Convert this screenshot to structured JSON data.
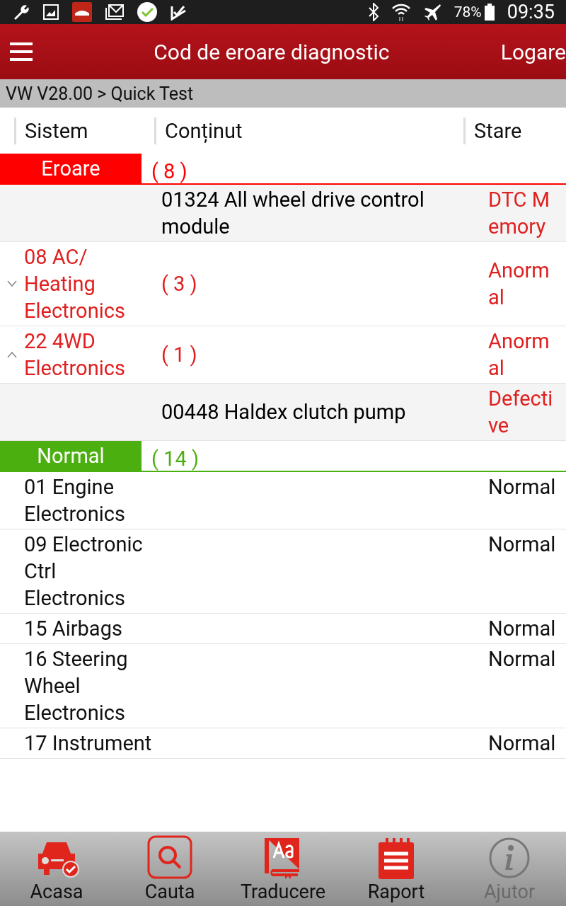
{
  "status_bar": {
    "battery": "78%",
    "time": "09:35"
  },
  "header": {
    "title": "Cod de eroare diagnostic",
    "action": "Logare"
  },
  "breadcrumb": "VW V28.00 > Quick Test",
  "columns": [
    "Sistem",
    "Conținut",
    "Stare"
  ],
  "sections": [
    {
      "kind": "error",
      "label": "Eroare",
      "count": "( 8 )",
      "rows": [
        {
          "kind": "detail",
          "content": "01324 All wheel drive control module",
          "status": "DTC Memory"
        },
        {
          "kind": "system",
          "system": "08 AC/ Heating Electronics",
          "count": "( 3 )",
          "status": "Anormal",
          "expanded": false
        },
        {
          "kind": "system",
          "system": "22 4WD Electronics",
          "count": "( 1 )",
          "status": "Anormal",
          "expanded": true
        },
        {
          "kind": "detail",
          "content": "00448 Haldex clutch pump",
          "status": "Defective"
        }
      ]
    },
    {
      "kind": "normal",
      "label": "Normal",
      "count": "( 14 )",
      "rows": [
        {
          "kind": "plain",
          "system": "01 Engine Electronics",
          "status": "Normal"
        },
        {
          "kind": "plain",
          "system": "09 Electronic Ctrl Electronics",
          "status": "Normal"
        },
        {
          "kind": "plain",
          "system": "15 Airbags",
          "status": "Normal"
        },
        {
          "kind": "plain",
          "system": "16 Steering Wheel Electronics",
          "status": "Normal"
        },
        {
          "kind": "plain",
          "system": "17 Instrument",
          "status": "Normal"
        }
      ]
    }
  ],
  "nav": [
    {
      "kind": "car",
      "label": "Acasa",
      "disabled": false
    },
    {
      "kind": "search",
      "label": "Cauta",
      "disabled": false
    },
    {
      "kind": "translate",
      "label": "Traducere",
      "disabled": false
    },
    {
      "kind": "report",
      "label": "Raport",
      "disabled": false
    },
    {
      "kind": "info",
      "label": "Ajutor",
      "disabled": true
    }
  ]
}
